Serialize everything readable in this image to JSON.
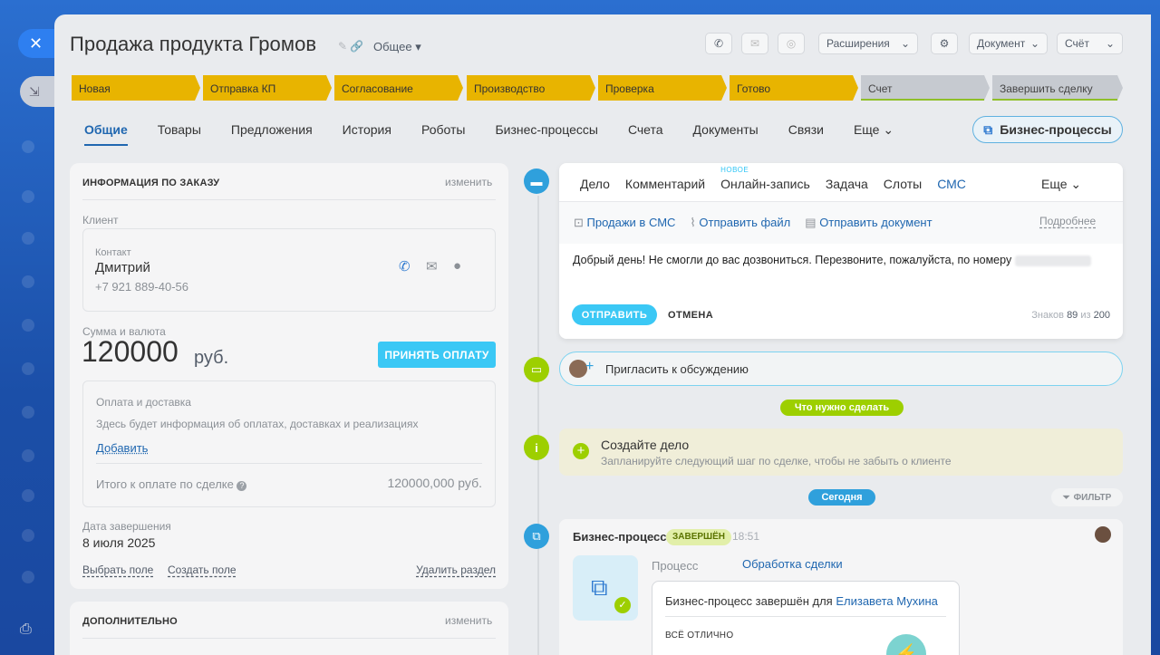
{
  "deal": {
    "title": "Продажа продукта Громов",
    "category": "Общее"
  },
  "header": {
    "extensions": "Расширения",
    "document": "Документ",
    "invoice": "Счёт"
  },
  "stages": [
    "Новая",
    "Отправка КП",
    "Согласование",
    "Производство",
    "Проверка",
    "Готово",
    "Счет",
    "Завершить сделку"
  ],
  "tabs": [
    "Общие",
    "Товары",
    "Предложения",
    "История",
    "Роботы",
    "Бизнес-процессы",
    "Счета",
    "Документы",
    "Связи",
    "Еще"
  ],
  "bp_button": "Бизнес-процессы",
  "order": {
    "section_title": "ИНФОРМАЦИЯ ПО ЗАКАЗУ",
    "edit": "изменить",
    "client_label": "Клиент",
    "contact_label": "Контакт",
    "contact_name": "Дмитрий",
    "contact_phone": "+7 921 889-40-56",
    "amount_label": "Сумма и валюта",
    "amount": "120000",
    "currency": "руб.",
    "accept_payment": "ПРИНЯТЬ ОПЛАТУ",
    "payment_title": "Оплата и доставка",
    "payment_desc": "Здесь будет информация об оплатах, доставках и реализациях",
    "add": "Добавить",
    "total_label": "Итого к оплате по сделке",
    "total_value": "120000,000 руб.",
    "close_date_label": "Дата завершения",
    "close_date": "8 июля 2025",
    "choose_field": "Выбрать поле",
    "create_field": "Создать поле",
    "delete_section": "Удалить раздел"
  },
  "additional": {
    "section_title": "ДОПОЛНИТЕЛЬНО",
    "edit": "изменить"
  },
  "sms": {
    "tabs": [
      "Дело",
      "Комментарий",
      "Онлайн-запись",
      "Задача",
      "Слоты",
      "СМС",
      "Еще"
    ],
    "new_badge": "НОВОЕ",
    "sales_in_sms": "Продажи в СМС",
    "send_file": "Отправить файл",
    "send_document": "Отправить документ",
    "more": "Подробнее",
    "message": "Добрый день! Не смогли до вас дозвониться. Перезвоните, пожалуйста, по номеру",
    "send": "ОТПРАВИТЬ",
    "cancel": "ОТМЕНА",
    "chars_label": "Знаков",
    "chars_count": "89",
    "of": "из",
    "chars_max": "200"
  },
  "feed": {
    "invite": "Пригласить к обсуждению",
    "todo_badge": "Что нужно сделать",
    "create_task_title": "Создайте дело",
    "create_task_desc": "Запланируйте следующий шаг по сделке, чтобы не забыть о клиенте",
    "today_badge": "Сегодня",
    "filter": "ФИЛЬТР",
    "bp_title": "Бизнес-процесс",
    "bp_status": "ЗАВЕРШЁН",
    "bp_time": "18:51",
    "process_label": "Процесс",
    "process_name": "Обработка сделки",
    "completed_for": "Бизнес-процесс завершён для",
    "completed_user": "Елизавета Мухина",
    "all_good": "ВСЁ ОТЛИЧНО"
  }
}
